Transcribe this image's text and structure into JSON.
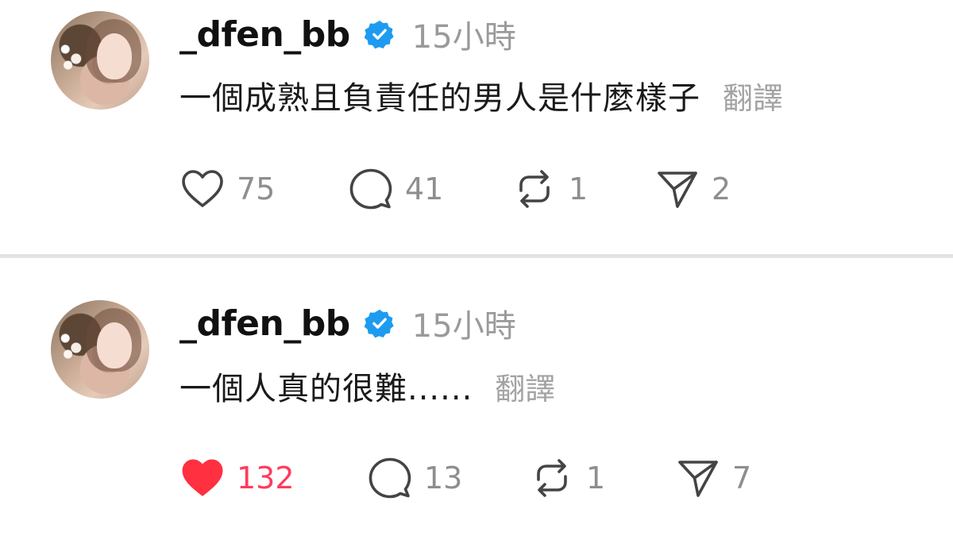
{
  "posts": [
    {
      "username": "_dfen_bb",
      "time": "15小時",
      "text": "一個成熟且負責任的男人是什麼樣子",
      "translate_label": "翻譯",
      "likes": "75",
      "liked": false,
      "comments": "41",
      "reposts": "1",
      "shares": "2"
    },
    {
      "username": "_dfen_bb",
      "time": "15小時",
      "text": "一個人真的很難......",
      "translate_label": "翻譯",
      "likes": "132",
      "liked": true,
      "comments": "13",
      "reposts": "1",
      "shares": "7"
    }
  ],
  "icons": {
    "like": "heart-icon",
    "comment": "comment-bubble-icon",
    "repost": "repost-icon",
    "share": "send-icon",
    "verified": "verified-badge-icon"
  },
  "colors": {
    "verified": "#1d9bf0",
    "liked": "#ff3b5c",
    "muted": "#8e8e8e"
  }
}
